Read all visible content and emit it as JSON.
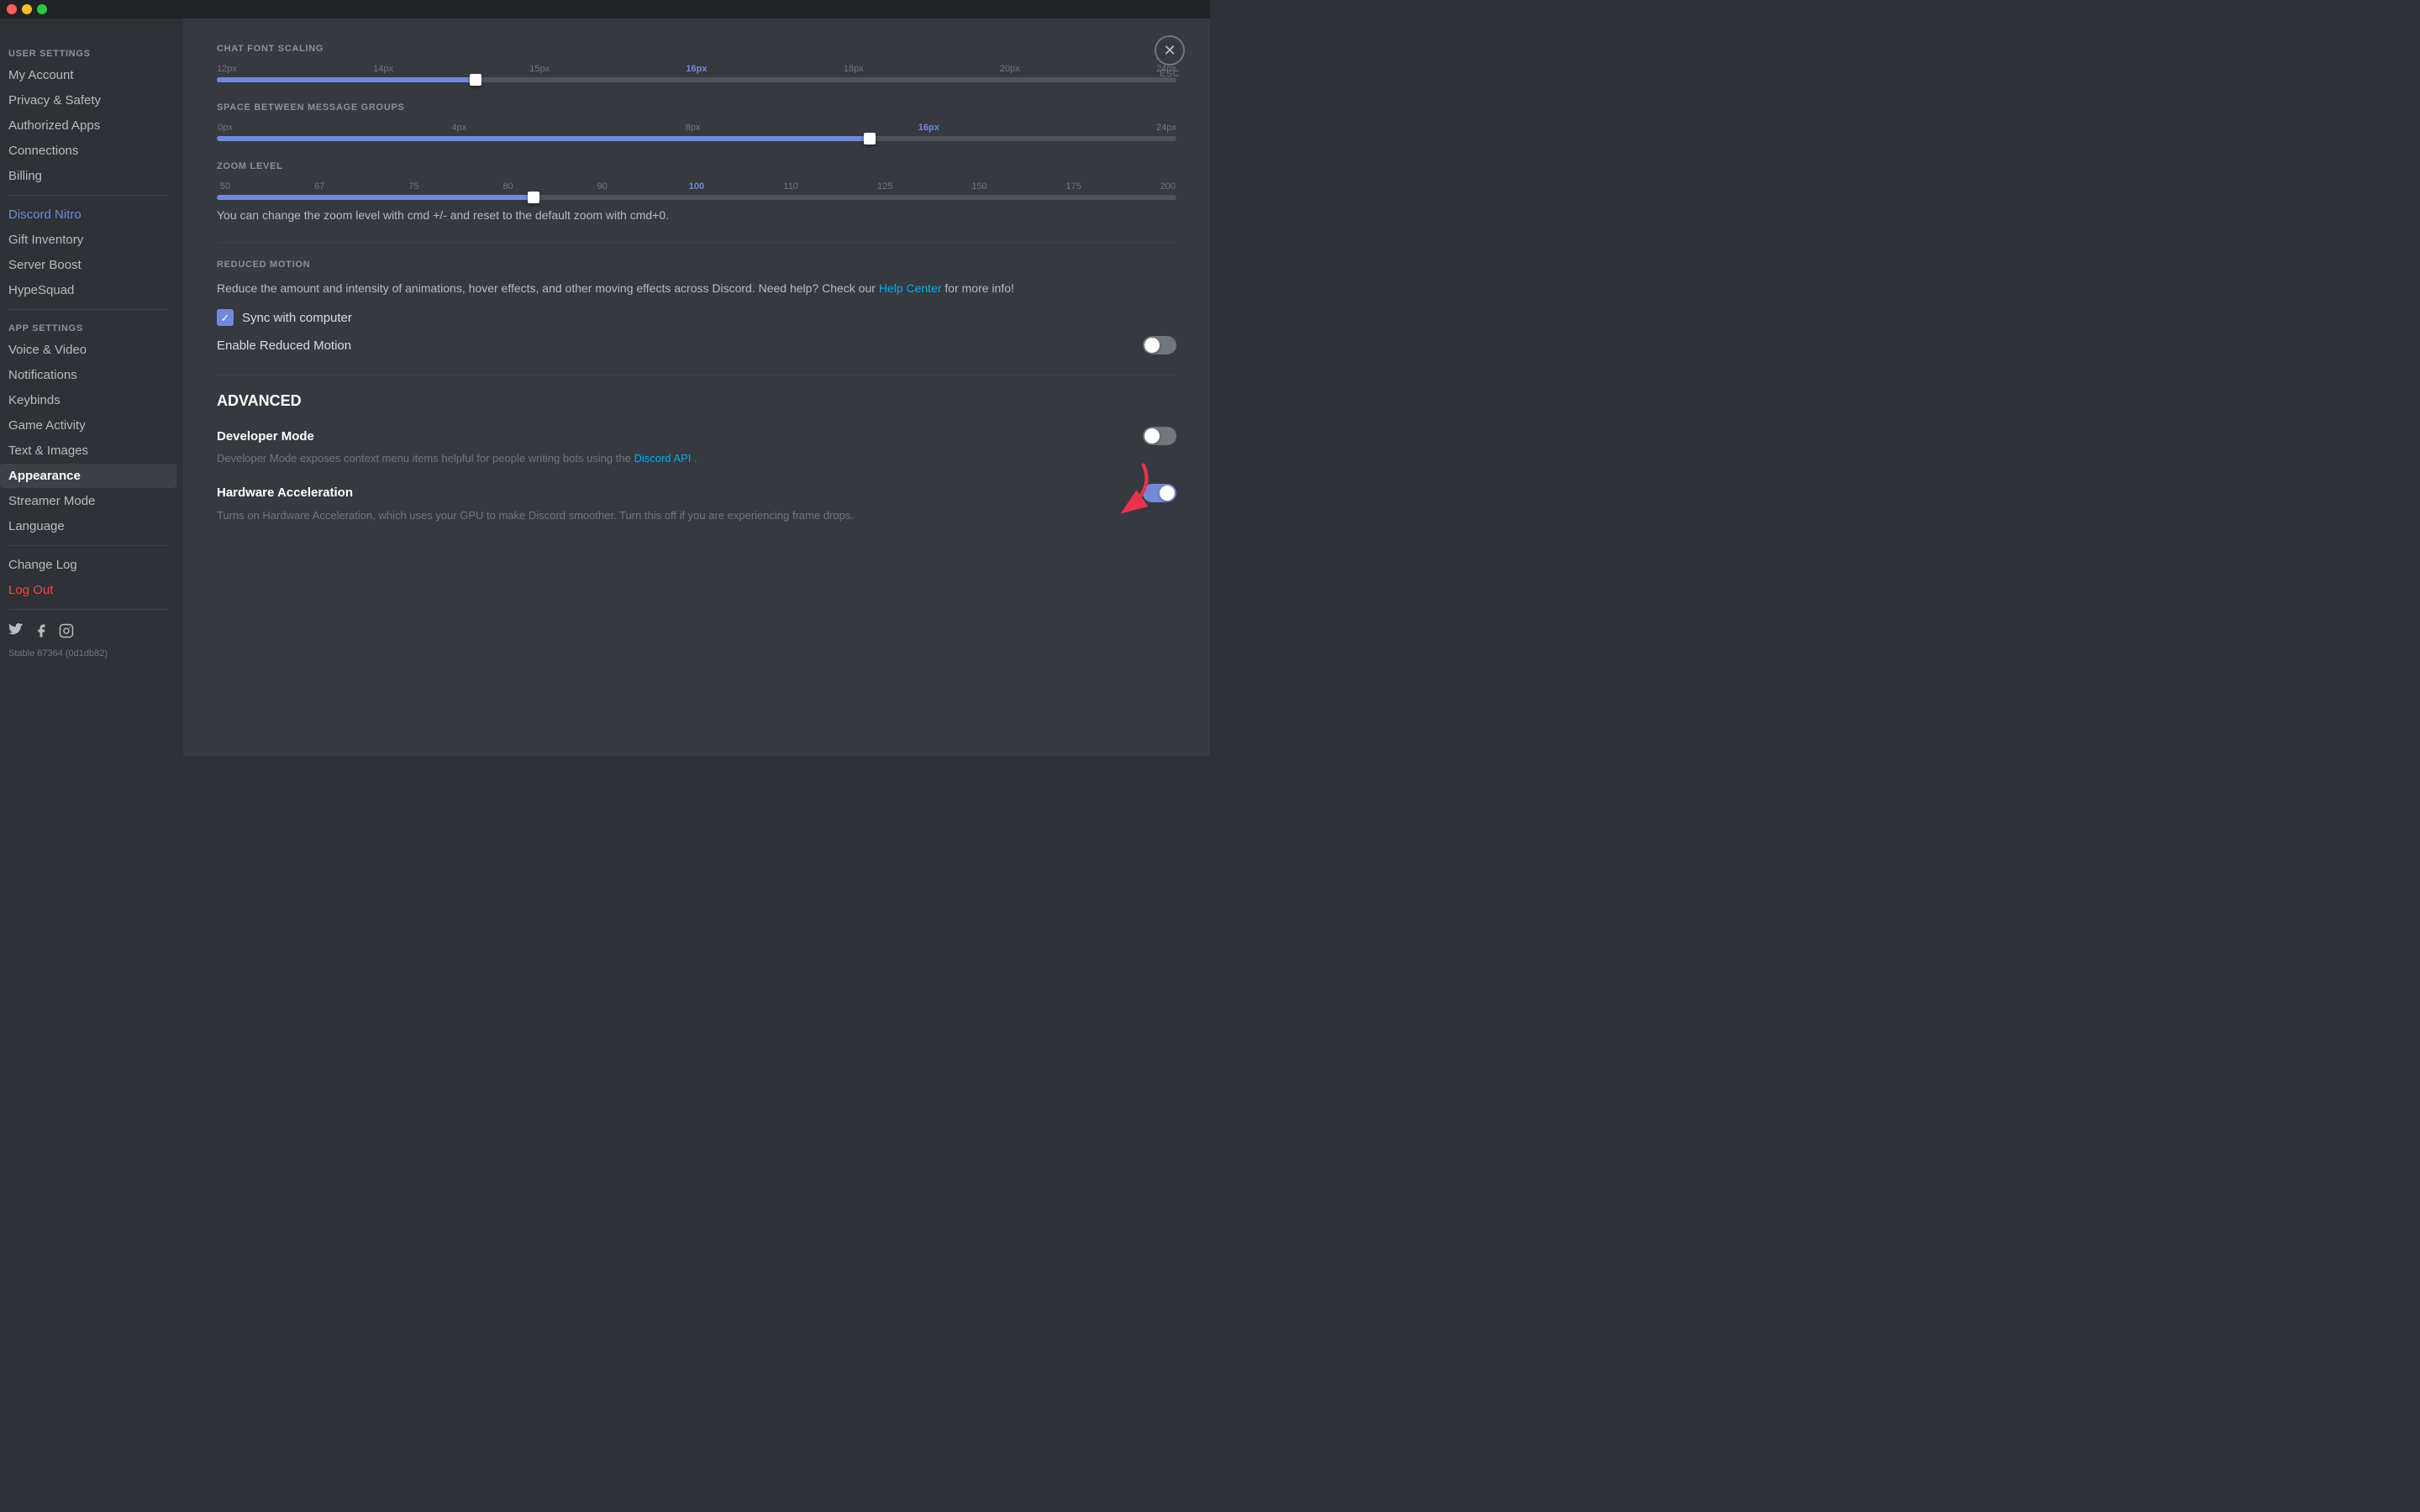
{
  "titlebar": {
    "close_label": "close",
    "min_label": "minimize",
    "max_label": "maximize"
  },
  "sidebar": {
    "user_settings_header": "USER SETTINGS",
    "app_settings_header": "APP SETTINGS",
    "items_user": [
      {
        "id": "my-account",
        "label": "My Account",
        "active": false,
        "style": "normal"
      },
      {
        "id": "privacy-safety",
        "label": "Privacy & Safety",
        "active": false,
        "style": "normal"
      },
      {
        "id": "authorized-apps",
        "label": "Authorized Apps",
        "active": false,
        "style": "normal"
      },
      {
        "id": "connections",
        "label": "Connections",
        "active": false,
        "style": "normal"
      },
      {
        "id": "billing",
        "label": "Billing",
        "active": false,
        "style": "normal"
      }
    ],
    "items_nitro": [
      {
        "id": "discord-nitro",
        "label": "Discord Nitro",
        "active": false,
        "style": "nitro"
      },
      {
        "id": "gift-inventory",
        "label": "Gift Inventory",
        "active": false,
        "style": "normal"
      },
      {
        "id": "server-boost",
        "label": "Server Boost",
        "active": false,
        "style": "normal"
      },
      {
        "id": "hypesquad",
        "label": "HypeSquad",
        "active": false,
        "style": "normal"
      }
    ],
    "items_app": [
      {
        "id": "voice-video",
        "label": "Voice & Video",
        "active": false,
        "style": "normal"
      },
      {
        "id": "notifications",
        "label": "Notifications",
        "active": false,
        "style": "normal"
      },
      {
        "id": "keybinds",
        "label": "Keybinds",
        "active": false,
        "style": "normal"
      },
      {
        "id": "game-activity",
        "label": "Game Activity",
        "active": false,
        "style": "normal"
      },
      {
        "id": "text-images",
        "label": "Text & Images",
        "active": false,
        "style": "normal"
      },
      {
        "id": "appearance",
        "label": "Appearance",
        "active": true,
        "style": "normal"
      },
      {
        "id": "streamer-mode",
        "label": "Streamer Mode",
        "active": false,
        "style": "normal"
      },
      {
        "id": "language",
        "label": "Language",
        "active": false,
        "style": "normal"
      }
    ],
    "items_bottom": [
      {
        "id": "change-log",
        "label": "Change Log",
        "active": false,
        "style": "normal"
      },
      {
        "id": "log-out",
        "label": "Log Out",
        "active": false,
        "style": "danger"
      }
    ],
    "version": "Stable 67364 (0d1db82)"
  },
  "main": {
    "close_label": "ESC",
    "chat_font_scaling": {
      "label": "CHAT FONT SCALING",
      "ticks": [
        "12px",
        "14px",
        "15px",
        "16px",
        "18px",
        "20px",
        "24px"
      ],
      "active_value": "16px",
      "active_index": 3,
      "fill_pct": 27
    },
    "space_between_groups": {
      "label": "SPACE BETWEEN MESSAGE GROUPS",
      "ticks": [
        "0px",
        "4px",
        "8px",
        "16px",
        "24px"
      ],
      "active_value": "16px",
      "active_index": 3,
      "fill_pct": 68
    },
    "zoom_level": {
      "label": "ZOOM LEVEL",
      "ticks": [
        "50",
        "67",
        "75",
        "80",
        "90",
        "100",
        "110",
        "125",
        "150",
        "175",
        "200"
      ],
      "active_value": "100",
      "active_index": 5,
      "fill_pct": 33,
      "hint": "You can change the zoom level with cmd +/- and reset to the default zoom with cmd+0."
    },
    "reduced_motion": {
      "label": "REDUCED MOTION",
      "description": "Reduce the amount and intensity of animations, hover effects, and other moving effects across Discord. Need help? Check our",
      "link_text": "Help Center",
      "description_suffix": " for more info!",
      "sync_label": "Sync with computer",
      "sync_checked": true,
      "enable_label": "Enable Reduced Motion",
      "enable_on": false
    },
    "advanced": {
      "header": "ADVANCED",
      "developer_mode": {
        "title": "Developer Mode",
        "description": "Developer Mode exposes context menu items helpful for people writing bots using the",
        "link_text": "Discord API",
        "description_suffix": ".",
        "on": false
      },
      "hardware_acceleration": {
        "title": "Hardware Acceleration",
        "description": "Turns on Hardware Acceleration, which uses your GPU to make Discord smoother. Turn this off if you are experiencing frame drops.",
        "on": true
      }
    }
  }
}
